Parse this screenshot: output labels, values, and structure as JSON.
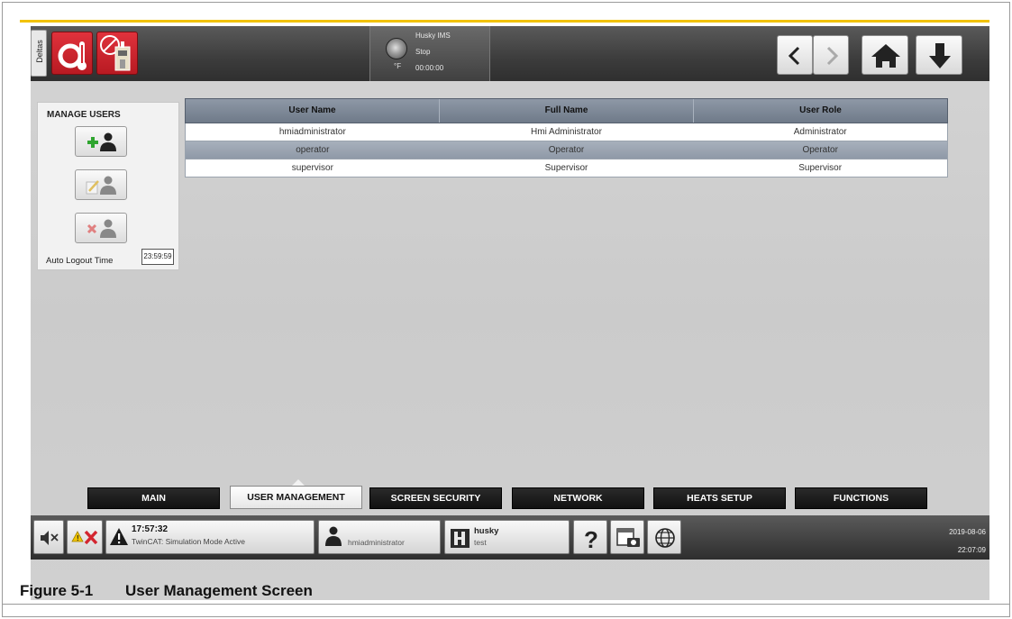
{
  "topbar": {
    "deltas_label": "Deltas",
    "status_name": "Husky IMS",
    "status_state": "Stop",
    "status_time": "00:00:00",
    "status_temp": "°F"
  },
  "manage_users": {
    "title": "MANAGE USERS",
    "auto_logout_label": "Auto Logout Time",
    "auto_logout_value": "23:59:59"
  },
  "table": {
    "headers": [
      "User Name",
      "Full Name",
      "User Role"
    ],
    "rows": [
      [
        "hmiadministrator",
        "Hmi Administrator",
        "Administrator"
      ],
      [
        "operator",
        "Operator",
        "Operator"
      ],
      [
        "supervisor",
        "Supervisor",
        "Supervisor"
      ]
    ]
  },
  "tabs": [
    {
      "label": "MAIN"
    },
    {
      "label": "USER MANAGEMENT"
    },
    {
      "label": "SCREEN SECURITY"
    },
    {
      "label": "NETWORK"
    },
    {
      "label": "HEATS SETUP"
    },
    {
      "label": "FUNCTIONS"
    }
  ],
  "statusbar": {
    "alarm_time": "17:57:32",
    "alarm_text": "TwinCAT: Simulation Mode Active",
    "user": "hmiadministrator",
    "mold_name": "husky",
    "mold_sub": "test",
    "date": "2019-08-06",
    "time": "22:07:09"
  },
  "caption": {
    "number": "Figure 5-1",
    "title": "User Management Screen"
  },
  "colors": {
    "accent_rule": "#f2c200",
    "alarm_red": "#d32630",
    "add_green": "#2fa52f"
  }
}
